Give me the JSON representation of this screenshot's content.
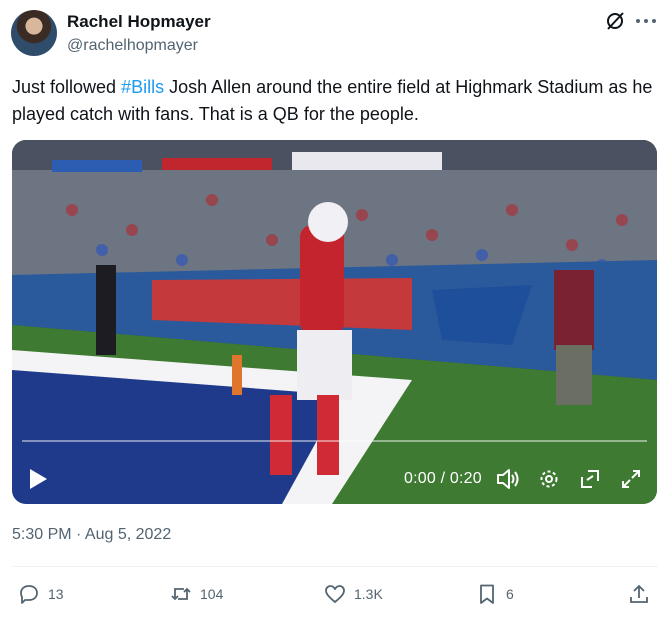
{
  "author": {
    "name": "Rachel Hopmayer",
    "handle": "@rachelhopmayer"
  },
  "tweet": {
    "text_before": "Just followed ",
    "hashtag": "#Bills",
    "text_after": " Josh Allen around the entire field at Highmark Stadium as he played catch with fans. That is a QB for the people.",
    "timestamp": "5:30 PM · Aug 5, 2022"
  },
  "video": {
    "time_display": "0:00 / 0:20",
    "progress": 0
  },
  "stats": {
    "replies": "13",
    "retweets": "104",
    "likes": "1.3K",
    "bookmarks": "6"
  },
  "icons": {
    "grok": "grok-icon",
    "more": "more-icon",
    "play": "play-icon",
    "volume": "volume-icon",
    "settings": "gear-icon",
    "pip": "picture-in-picture-icon",
    "fullscreen": "fullscreen-icon",
    "reply": "reply-icon",
    "retweet": "retweet-icon",
    "like": "heart-icon",
    "bookmark": "bookmark-icon",
    "share": "share-icon"
  },
  "colors": {
    "link": "#1d9bf0",
    "text": "#0f1419",
    "secondary": "#536471"
  }
}
